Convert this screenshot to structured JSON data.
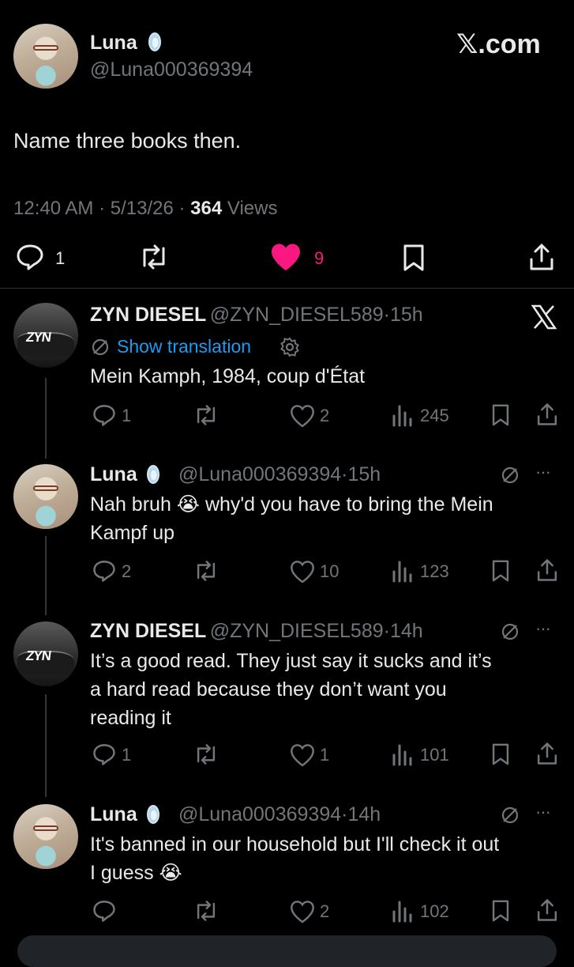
{
  "main_tweet": {
    "author_name": "Luna",
    "author_handle": "@Luna000369394",
    "brand": "𝕏.com",
    "text": "Name three books then.",
    "time": "12:40 AM",
    "date": "5/13/26",
    "views_count": "364",
    "views_label": "Views",
    "replies": "1",
    "likes": "9",
    "colors": {
      "like_active": "#f91880",
      "text": "#e7e9ea",
      "muted": "#71767b"
    }
  },
  "replies": [
    {
      "author_name": "ZYN DIESEL",
      "author_handle": "@ZYN_DIESEL589",
      "age": "15h",
      "translation_label": "Show translation",
      "text": "Mein Kamph, 1984, coup d'État",
      "replies": "1",
      "likes": "2",
      "views": "245",
      "avatar_text": "ZYN"
    },
    {
      "author_name": "Luna",
      "author_handle": "@Luna000369394",
      "age": "15h",
      "text_line1": "Nah bruh 😭 why'd you have to bring the Mein",
      "text_line2": "Kampf up",
      "replies": "2",
      "likes": "10",
      "views": "123"
    },
    {
      "author_name": "ZYN DIESEL",
      "author_handle": "@ZYN_DIESEL589",
      "age": "14h",
      "text_line1": "It’s a good read. They just say it sucks and it’s",
      "text_line2": "a hard read because they don’t want you",
      "text_line3": "reading it",
      "replies": "1",
      "likes": "1",
      "views": "101",
      "avatar_text": "ZYN"
    },
    {
      "author_name": "Luna",
      "author_handle": "@Luna000369394",
      "age": "14h",
      "text_line1": "It's banned in our household but I'll check it out",
      "text_line2": "I guess 😭",
      "likes": "2",
      "views": "102"
    }
  ],
  "separator": "·",
  "more_label": "···"
}
